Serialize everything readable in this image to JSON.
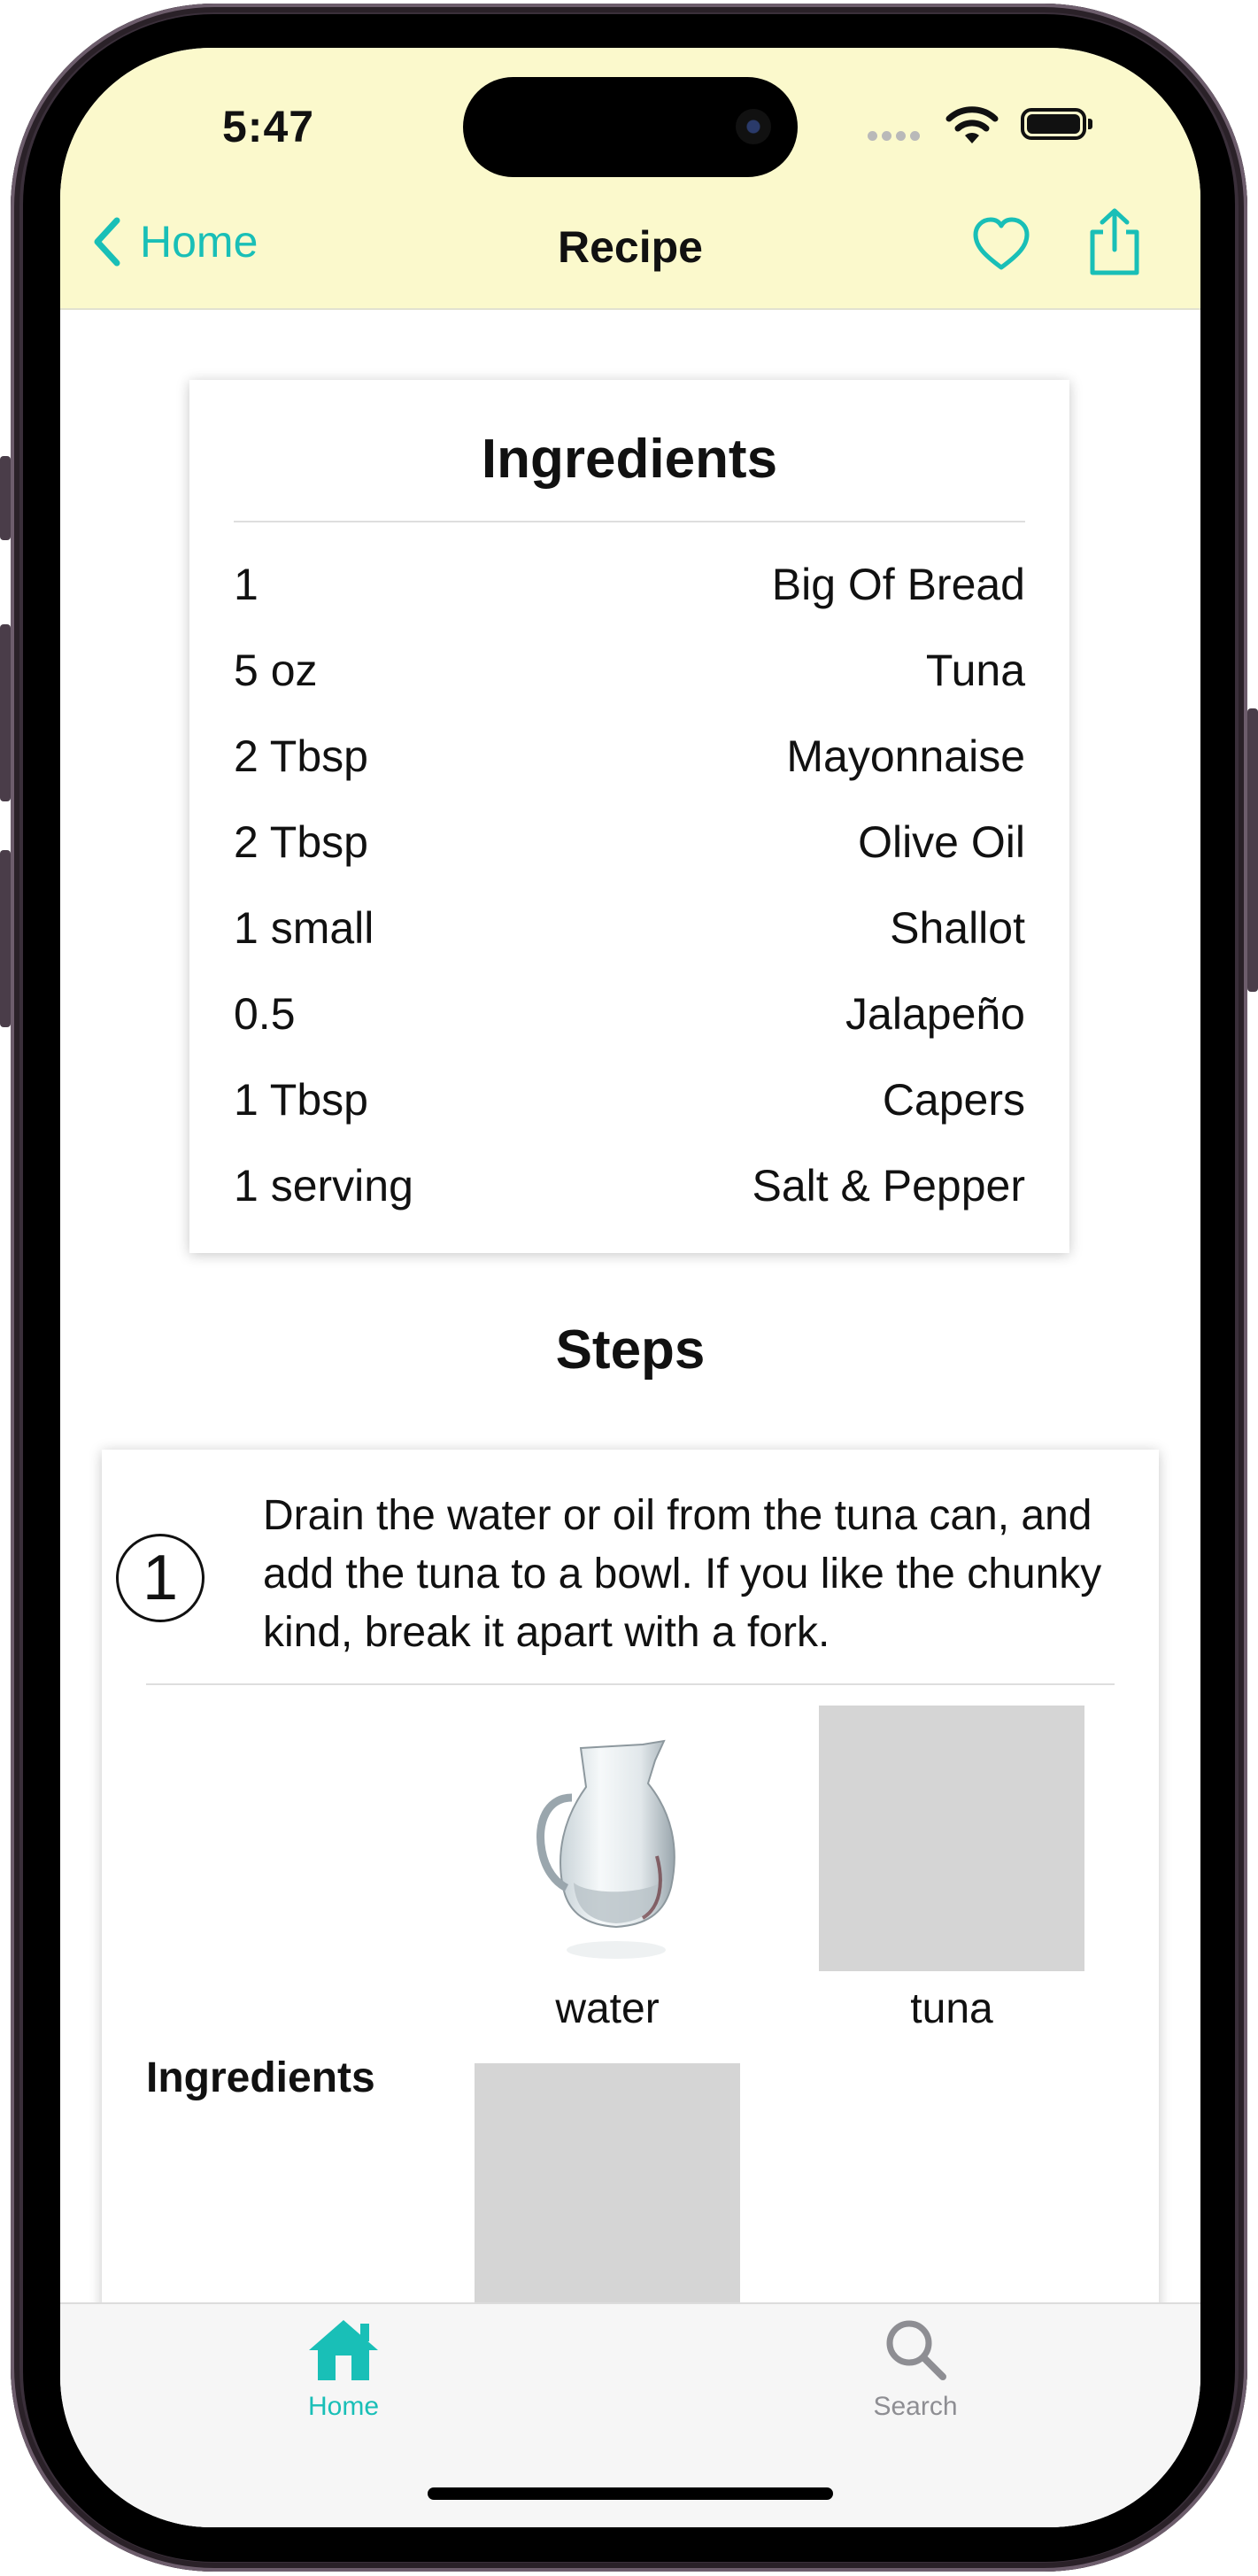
{
  "status_bar": {
    "time": "5:47"
  },
  "nav": {
    "back_label": "Home",
    "title": "Recipe"
  },
  "ingredients_card": {
    "title": "Ingredients",
    "rows": [
      {
        "qty": "1",
        "name": "Big Of Bread"
      },
      {
        "qty": "5 oz",
        "name": "Tuna"
      },
      {
        "qty": "2 Tbsp",
        "name": "Mayonnaise"
      },
      {
        "qty": "2 Tbsp",
        "name": "Olive Oil"
      },
      {
        "qty": "1 small",
        "name": "Shallot"
      },
      {
        "qty": "0.5",
        "name": "Jalapeño"
      },
      {
        "qty": "1 Tbsp",
        "name": "Capers"
      },
      {
        "qty": "1 serving",
        "name": "Salt & Pepper"
      }
    ]
  },
  "steps": {
    "title": "Steps",
    "items": [
      {
        "number": "1",
        "text": "Drain the water or oil from the tuna can, and add the tuna to a bowl.  If you like the chunky kind, break it apart with a fork.",
        "ingredients_label": "Ingredients",
        "ingredients": [
          {
            "label": "water",
            "image": "water-pitcher-photo"
          },
          {
            "label": "tuna",
            "image": "placeholder"
          },
          {
            "label": "",
            "image": "placeholder"
          }
        ]
      }
    ]
  },
  "tabbar": {
    "tabs": [
      {
        "label": "Home",
        "icon": "house-icon",
        "active": true
      },
      {
        "label": "Search",
        "icon": "magnifier-icon",
        "active": false
      }
    ]
  },
  "colors": {
    "accent": "#19bfb7",
    "header_bg": "#fbf9cc",
    "inactive_tab": "#8e8e93",
    "placeholder": "#d5d5d5"
  }
}
